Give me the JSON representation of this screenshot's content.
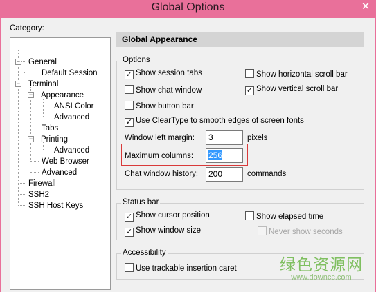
{
  "window": {
    "title": "Global Options",
    "close_glyph": "✕"
  },
  "category": {
    "label": "Category:",
    "items": [
      {
        "label": "General"
      },
      {
        "label": "Default Session"
      },
      {
        "label": "Terminal"
      },
      {
        "label": "Appearance"
      },
      {
        "label": "ANSI Color"
      },
      {
        "label": "Advanced"
      },
      {
        "label": "Tabs"
      },
      {
        "label": "Printing"
      },
      {
        "label": "Advanced"
      },
      {
        "label": "Web Browser"
      },
      {
        "label": "Advanced"
      },
      {
        "label": "Firewall"
      },
      {
        "label": "SSH2"
      },
      {
        "label": "SSH Host Keys"
      }
    ],
    "selected": "Appearance"
  },
  "panel": {
    "header": "Global Appearance",
    "options": {
      "title": "Options",
      "show_session_tabs": {
        "label": "Show session tabs",
        "checked": true
      },
      "show_horizontal_scroll_bar": {
        "label": "Show horizontal scroll bar",
        "checked": false
      },
      "show_chat_window": {
        "label": "Show chat window",
        "checked": false
      },
      "show_vertical_scroll_bar": {
        "label": "Show vertical scroll bar",
        "checked": true
      },
      "show_button_bar": {
        "label": "Show button bar",
        "checked": false
      },
      "use_cleartype": {
        "label": "Use ClearType to smooth edges of screen fonts",
        "checked": true
      },
      "window_left_margin": {
        "label": "Window left margin:",
        "value": "3",
        "unit": "pixels"
      },
      "maximum_columns": {
        "label": "Maximum columns:",
        "value": "256"
      },
      "chat_window_history": {
        "label": "Chat window history:",
        "value": "200",
        "unit": "commands"
      }
    },
    "status_bar": {
      "title": "Status bar",
      "show_cursor_position": {
        "label": "Show cursor position",
        "checked": true
      },
      "show_elapsed_time": {
        "label": "Show elapsed time",
        "checked": false
      },
      "show_window_size": {
        "label": "Show window size",
        "checked": true
      },
      "never_show_seconds": {
        "label": "Never show seconds",
        "checked": false,
        "disabled": true
      }
    },
    "accessibility": {
      "title": "Accessibility",
      "trackable_caret": {
        "label": "Use trackable insertion caret",
        "checked": false
      }
    }
  },
  "watermark": {
    "main": "绿色资源网",
    "sub": "www.downcc.com"
  },
  "colors": {
    "titlebar": "#e9709a",
    "highlight": "#d93a3a",
    "selection": "#3399ff"
  },
  "icons": {
    "expand": "⊟",
    "check": "✓"
  }
}
